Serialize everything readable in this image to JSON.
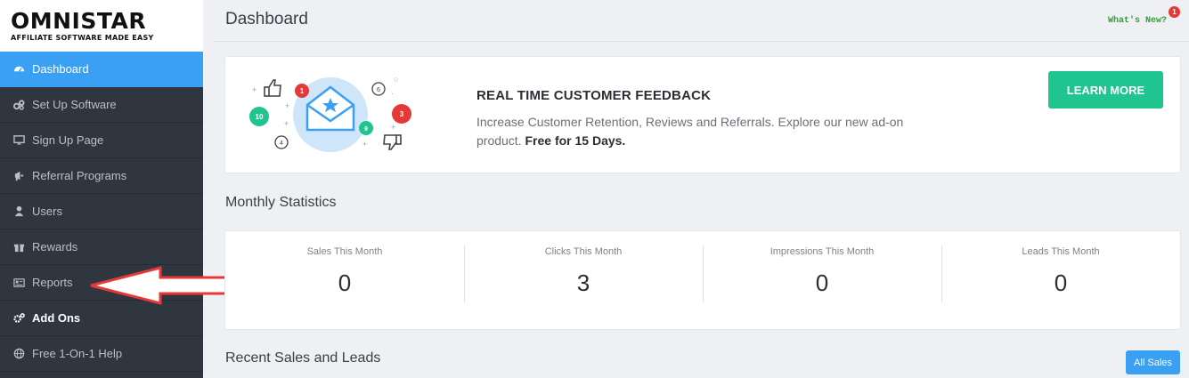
{
  "logo": {
    "brand": "OMNISTAR",
    "tagline": "AFFILIATE SOFTWARE MADE EASY"
  },
  "sidebar": {
    "items": [
      {
        "label": "Dashboard",
        "icon": "dashboard-icon",
        "active": true
      },
      {
        "label": "Set Up Software",
        "icon": "cogs-icon"
      },
      {
        "label": "Sign Up Page",
        "icon": "monitor-icon"
      },
      {
        "label": "Referral Programs",
        "icon": "megaphone-icon"
      },
      {
        "label": "Users",
        "icon": "user-icon"
      },
      {
        "label": "Rewards",
        "icon": "gift-icon"
      },
      {
        "label": "Reports",
        "icon": "report-card-icon"
      },
      {
        "label": "Add Ons",
        "icon": "gears-icon",
        "bold": true
      },
      {
        "label": "Free 1-On-1 Help",
        "icon": "globe-icon"
      }
    ]
  },
  "header": {
    "title": "Dashboard",
    "whats_new": "What's New?",
    "notification_count": "1"
  },
  "feedback": {
    "title": "REAL TIME CUSTOMER FEEDBACK",
    "description": "Increase Customer Retention, Reviews and Referrals. Explore our new ad-on product.",
    "highlight": "Free for 15 Days.",
    "button": "LEARN MORE",
    "badges": [
      "1",
      "10",
      "3",
      "9",
      "6",
      "4"
    ]
  },
  "monthly": {
    "title": "Monthly Statistics",
    "stats": [
      {
        "label": "Sales This Month",
        "value": "0"
      },
      {
        "label": "Clicks This Month",
        "value": "3"
      },
      {
        "label": "Impressions This Month",
        "value": "0"
      },
      {
        "label": "Leads This Month",
        "value": "0"
      }
    ]
  },
  "recent": {
    "title": "Recent Sales and Leads",
    "button": "All Sales"
  },
  "colors": {
    "accent": "#3aa0f3",
    "success": "#1fc48e",
    "sidebar": "#2f3640",
    "annotation": "#e53935"
  }
}
